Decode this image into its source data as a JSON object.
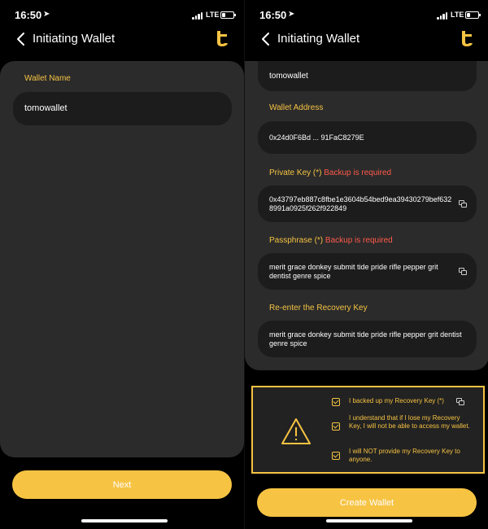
{
  "status": {
    "time": "16:50",
    "network": "LTE"
  },
  "nav": {
    "title": "Initiating Wallet"
  },
  "left": {
    "wallet_name_label": "Wallet Name",
    "wallet_name_value": "tomowallet",
    "next_label": "Next"
  },
  "right": {
    "wallet_name_value": "tomowallet",
    "address_label": "Wallet Address",
    "address_value": "0x24d0F6Bd ... 91FaC8279E",
    "private_key_label": "Private Key (*)",
    "private_key_required": "Backup is required",
    "private_key_value": "0x43797eb887c8fbe1e3604b54bed9ea39430279bef6328991a0925f262f922849",
    "passphrase_label": "Passphrase (*)",
    "passphrase_required": "Backup is required",
    "passphrase_value": "merit grace donkey submit tide pride rifle pepper grit dentist genre spice",
    "reenter_label": "Re-enter the Recovery Key",
    "reenter_value": "merit grace donkey submit tide pride rifle pepper grit dentist genre spice",
    "checks": [
      "I backed up my Recovery Key (*)",
      "I understand that if I lose my Recovery Key, I will not be able to access my wallet.",
      "I will NOT provide my Recovery Key to anyone."
    ],
    "create_label": "Create Wallet"
  },
  "colors": {
    "accent": "#f6c343",
    "required": "#ff5a4a",
    "card": "#2b2b2b",
    "field": "#1c1c1c"
  },
  "icons": [
    "back-chevron-icon",
    "tomo-logo-icon",
    "copy-icon",
    "warning-icon",
    "checkbox-icon"
  ]
}
